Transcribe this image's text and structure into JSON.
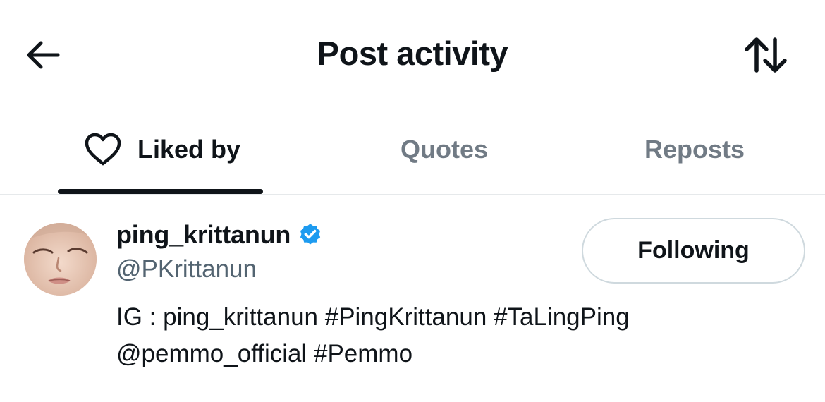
{
  "header": {
    "title": "Post activity",
    "back_icon": "arrow-left-icon",
    "sort_icon": "sort-arrows-icon"
  },
  "tabs": [
    {
      "label": "Liked by",
      "icon": "heart-outline-icon",
      "active": true
    },
    {
      "label": "Quotes",
      "active": false
    },
    {
      "label": "Reposts",
      "active": false
    }
  ],
  "user": {
    "display_name": "ping_krittanun",
    "verified": true,
    "handle": "@PKrittanun",
    "bio_line1": "IG : ping_krittanun #PingKrittanun #TaLingPing",
    "bio_line2": "@pemmo_official #Pemmo",
    "follow_label": "Following"
  },
  "colors": {
    "text_primary": "#0f1419",
    "text_secondary": "#536471",
    "tab_inactive": "#717b85",
    "verified_badge": "#1d9bf0",
    "divider": "#e6e9eb",
    "button_border": "#cfd9de"
  }
}
